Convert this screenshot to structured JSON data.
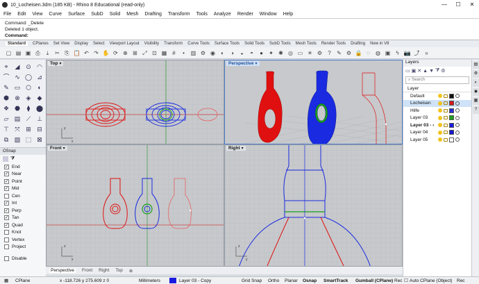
{
  "window": {
    "title": "10_Locheisen.3dm (185 KB) - Rhino 8 Educational (read-only)",
    "minimize": "—",
    "maximize": "☐",
    "close": "✕"
  },
  "menu": [
    "File",
    "Edit",
    "View",
    "Curve",
    "Surface",
    "SubD",
    "Solid",
    "Mesh",
    "Drafting",
    "Transform",
    "Tools",
    "Analyze",
    "Render",
    "Window",
    "Help"
  ],
  "command": {
    "line1": "Command: _Delete",
    "line2": "Deleted 1 object.",
    "prompt": "Command:"
  },
  "tabs": [
    "Standard",
    "CPlanes",
    "Set View",
    "Display",
    "Select",
    "Viewport Layout",
    "Visibility",
    "Transform",
    "Curve Tools",
    "Surface Tools",
    "Solid Tools",
    "SubD Tools",
    "Mesh Tools",
    "Render Tools",
    "Drafting",
    "New in V8"
  ],
  "toolbar_icons": [
    "new-file-icon",
    "open-file-icon",
    "save-icon",
    "print-icon",
    "import-icon",
    "cut-icon",
    "copy-icon",
    "paste-icon",
    "undo-icon",
    "redo-icon",
    "pan-icon",
    "rotate-view-icon",
    "zoom-icon",
    "zoom-window-icon",
    "zoom-extents-icon",
    "zoom-selected-icon",
    "four-viewports-icon",
    "grid-options-icon",
    "point-icon",
    "layer-icon",
    "properties-icon",
    "material-icon",
    "render-icon",
    "display-mode-icon",
    "rendered-view-icon",
    "ghosted-icon",
    "sphere-icon",
    "light-icon",
    "color-wheel-icon",
    "environment-icon",
    "ground-plane-icon",
    "sun-icon",
    "options-icon",
    "help-icon",
    "script-icon",
    "gear-icon",
    "lock-icon",
    "hide-icon",
    "show-icon",
    "snapshot-icon",
    "grasshopper-icon",
    "camera-icon",
    "export-icon",
    "toolbar-more-icon"
  ],
  "toolbar_glyphs": [
    "▢",
    "▤",
    "▣",
    "⎙",
    "⤓",
    "✂",
    "⎘",
    "📋",
    "↶",
    "↷",
    "✋",
    "⟳",
    "⊕",
    "⊞",
    "⤢",
    "⊡",
    "▦",
    "#",
    "•",
    "▥",
    "⚙",
    "◉",
    "◐",
    "◑",
    "◒",
    "◓",
    "●",
    "✦",
    "✺",
    "◎",
    "▭",
    "☀",
    "⚙",
    "?",
    "✎",
    "⚙",
    "🔒",
    "◌",
    "◍",
    "▣",
    "ϟ",
    "📷",
    "⤴",
    "»"
  ],
  "left_icons": [
    "⌖",
    "◢",
    "⊙",
    "◠",
    "⌒",
    "∿",
    "◯",
    "⊿",
    "✎",
    "▭",
    "⬡",
    "◐",
    "⬢",
    "⊗",
    "◈",
    "◆",
    "❖",
    "⬣",
    "⧫",
    "⬤",
    "▱",
    "▤",
    "⟋",
    "⊥",
    "⊤",
    "⤧",
    "⊞",
    "⊟",
    "⧉",
    "▧",
    "⬚",
    "⊠"
  ],
  "osnap": {
    "title": "OSnap",
    "items": [
      {
        "label": "End",
        "checked": true
      },
      {
        "label": "Near",
        "checked": true
      },
      {
        "label": "Point",
        "checked": true
      },
      {
        "label": "Mid",
        "checked": true
      },
      {
        "label": "Cen",
        "checked": false
      },
      {
        "label": "Int",
        "checked": true
      },
      {
        "label": "Perp",
        "checked": true
      },
      {
        "label": "Tan",
        "checked": true
      },
      {
        "label": "Quad",
        "checked": true
      },
      {
        "label": "Knot",
        "checked": false
      },
      {
        "label": "Vertex",
        "checked": false
      },
      {
        "label": "Project",
        "checked": false
      }
    ],
    "disable": "Disable"
  },
  "viewports": {
    "top": "Top",
    "perspective": "Perspective",
    "front": "Front",
    "right": "Right"
  },
  "viewport_tabs": [
    "Perspective",
    "Front",
    "Right",
    "Top",
    "⊕"
  ],
  "layers": {
    "title": "Layers",
    "search_placeholder": "Search",
    "header": "Layer",
    "rows": [
      {
        "name": "Default",
        "color": "#111111",
        "selected": false,
        "current": false
      },
      {
        "name": "Locheisen",
        "color": "#d91818",
        "selected": true,
        "current": false
      },
      {
        "name": "Hilfe",
        "color": "#2a2ad0",
        "selected": false,
        "current": false
      },
      {
        "name": "Layer 03",
        "color": "#1ba11b",
        "selected": false,
        "current": false
      },
      {
        "name": "Layer 03 - ‹",
        "color": "#1a1ae0",
        "selected": false,
        "current": true
      },
      {
        "name": "Layer 04",
        "color": "#1515d0",
        "selected": false,
        "current": false
      },
      {
        "name": "Layer 05",
        "color": "#ffffff",
        "selected": false,
        "current": false
      }
    ]
  },
  "status": {
    "cplane": "CPlane",
    "coords": "x -118.726  y 275.609  z 0",
    "units": "Millimeters",
    "layer": "Layer 03 - Copy",
    "gridsnap": "Grid Snap",
    "ortho": "Ortho",
    "planar": "Planar",
    "osnap": "Osnap",
    "smarttrack": "SmartTrack",
    "gumball": "Gumball (CPlane)",
    "record": "Rec",
    "autocplane": "Auto CPlane (Object)",
    "rec2": "Rec"
  },
  "colors": {
    "red": "#e01010",
    "blue": "#1a2ae0",
    "green": "#1aa01a",
    "grid": "#b4b7bb",
    "viewport_bg": "#c7c9cc"
  }
}
